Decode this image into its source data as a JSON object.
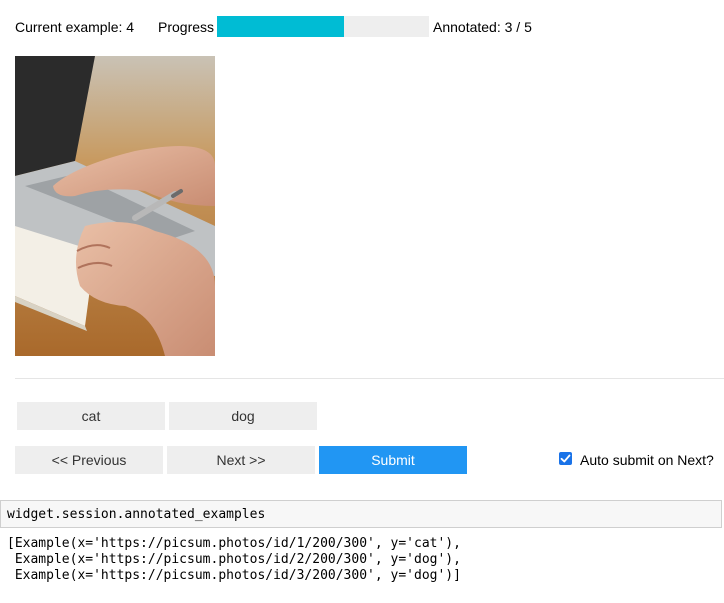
{
  "header": {
    "current_example_label": "Current example: 4",
    "progress_label": "Progress",
    "progress_fraction": 0.6,
    "annotated_label": "Annotated: 3 / 5",
    "progress_color": "#00bcd4"
  },
  "labels": {
    "buttons": [
      "cat",
      "dog"
    ]
  },
  "navigation": {
    "previous_label": "<< Previous",
    "next_label": "Next >>",
    "submit_label": "Submit",
    "auto_submit_label": "Auto submit on Next?",
    "auto_submit_checked": true,
    "submit_color": "#2196f3"
  },
  "notebook": {
    "code_input": "widget.session.annotated_examples",
    "output_lines": [
      "[Example(x='https://picsum.photos/id/1/200/300', y='cat'),",
      " Example(x='https://picsum.photos/id/2/200/300', y='dog'),",
      " Example(x='https://picsum.photos/id/3/200/300', y='dog')]"
    ]
  }
}
